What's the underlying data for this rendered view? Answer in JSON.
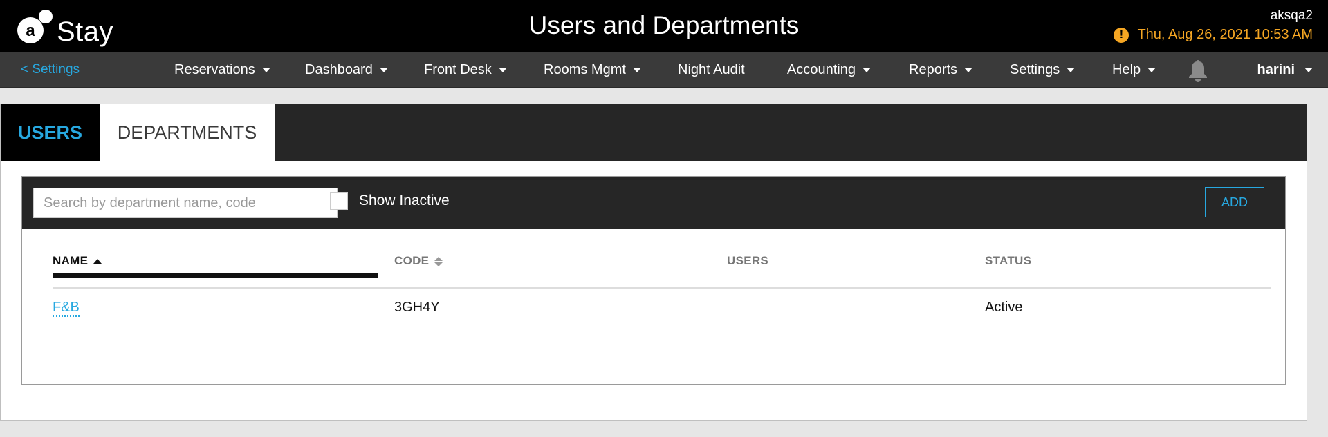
{
  "header": {
    "logo_text": "Stay",
    "title": "Users and Departments",
    "property": "aksqa2",
    "datetime": "Thu, Aug 26, 2021 10:53 AM",
    "colors": {
      "accent": "#27a8e0",
      "warning": "#f5a623"
    }
  },
  "nav": {
    "back_label": "< Settings",
    "items": [
      {
        "label": "Reservations"
      },
      {
        "label": "Dashboard"
      },
      {
        "label": "Front Desk"
      },
      {
        "label": "Rooms Mgmt"
      },
      {
        "label": "Night Audit"
      },
      {
        "label": "Accounting"
      },
      {
        "label": "Reports"
      },
      {
        "label": "Settings"
      },
      {
        "label": "Help"
      }
    ],
    "user": "harini",
    "icons": {
      "notifications": "bell-icon",
      "warning": "exclamation-icon"
    }
  },
  "tabs": [
    {
      "label": "USERS"
    },
    {
      "label": "DEPARTMENTS"
    }
  ],
  "toolbar": {
    "search_placeholder": "Search by department name, code",
    "show_inactive_label": "Show Inactive",
    "add_label": "ADD"
  },
  "table": {
    "columns": [
      "NAME",
      "CODE",
      "USERS",
      "STATUS"
    ],
    "rows": [
      {
        "name": "F&B",
        "code": "3GH4Y",
        "users": "",
        "status": "Active"
      }
    ]
  }
}
